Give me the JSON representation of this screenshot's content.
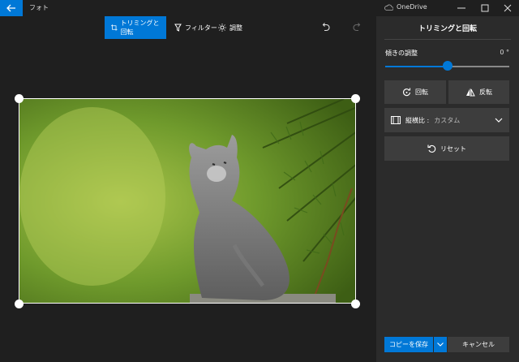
{
  "app": {
    "title": "フォト",
    "account": "OneDrive"
  },
  "toolbar": {
    "crop_label": "トリミングと回転",
    "filter_label": "フィルター",
    "adjust_label": "調整"
  },
  "panel": {
    "title": "トリミングと回転",
    "tilt_label": "傾きの調整",
    "tilt_value": "0 °",
    "tilt_position": 0.5,
    "rotate_label": "回転",
    "flip_label": "反転",
    "aspect_label": "縦横比 :",
    "aspect_value": "カスタム",
    "reset_label": "リセット",
    "save_label": "コピーを保存",
    "cancel_label": "キャンセル"
  },
  "colors": {
    "accent": "#0078d7",
    "panel": "#2b2b2b",
    "button": "#3d3d3d",
    "background": "#1f1f1f"
  }
}
